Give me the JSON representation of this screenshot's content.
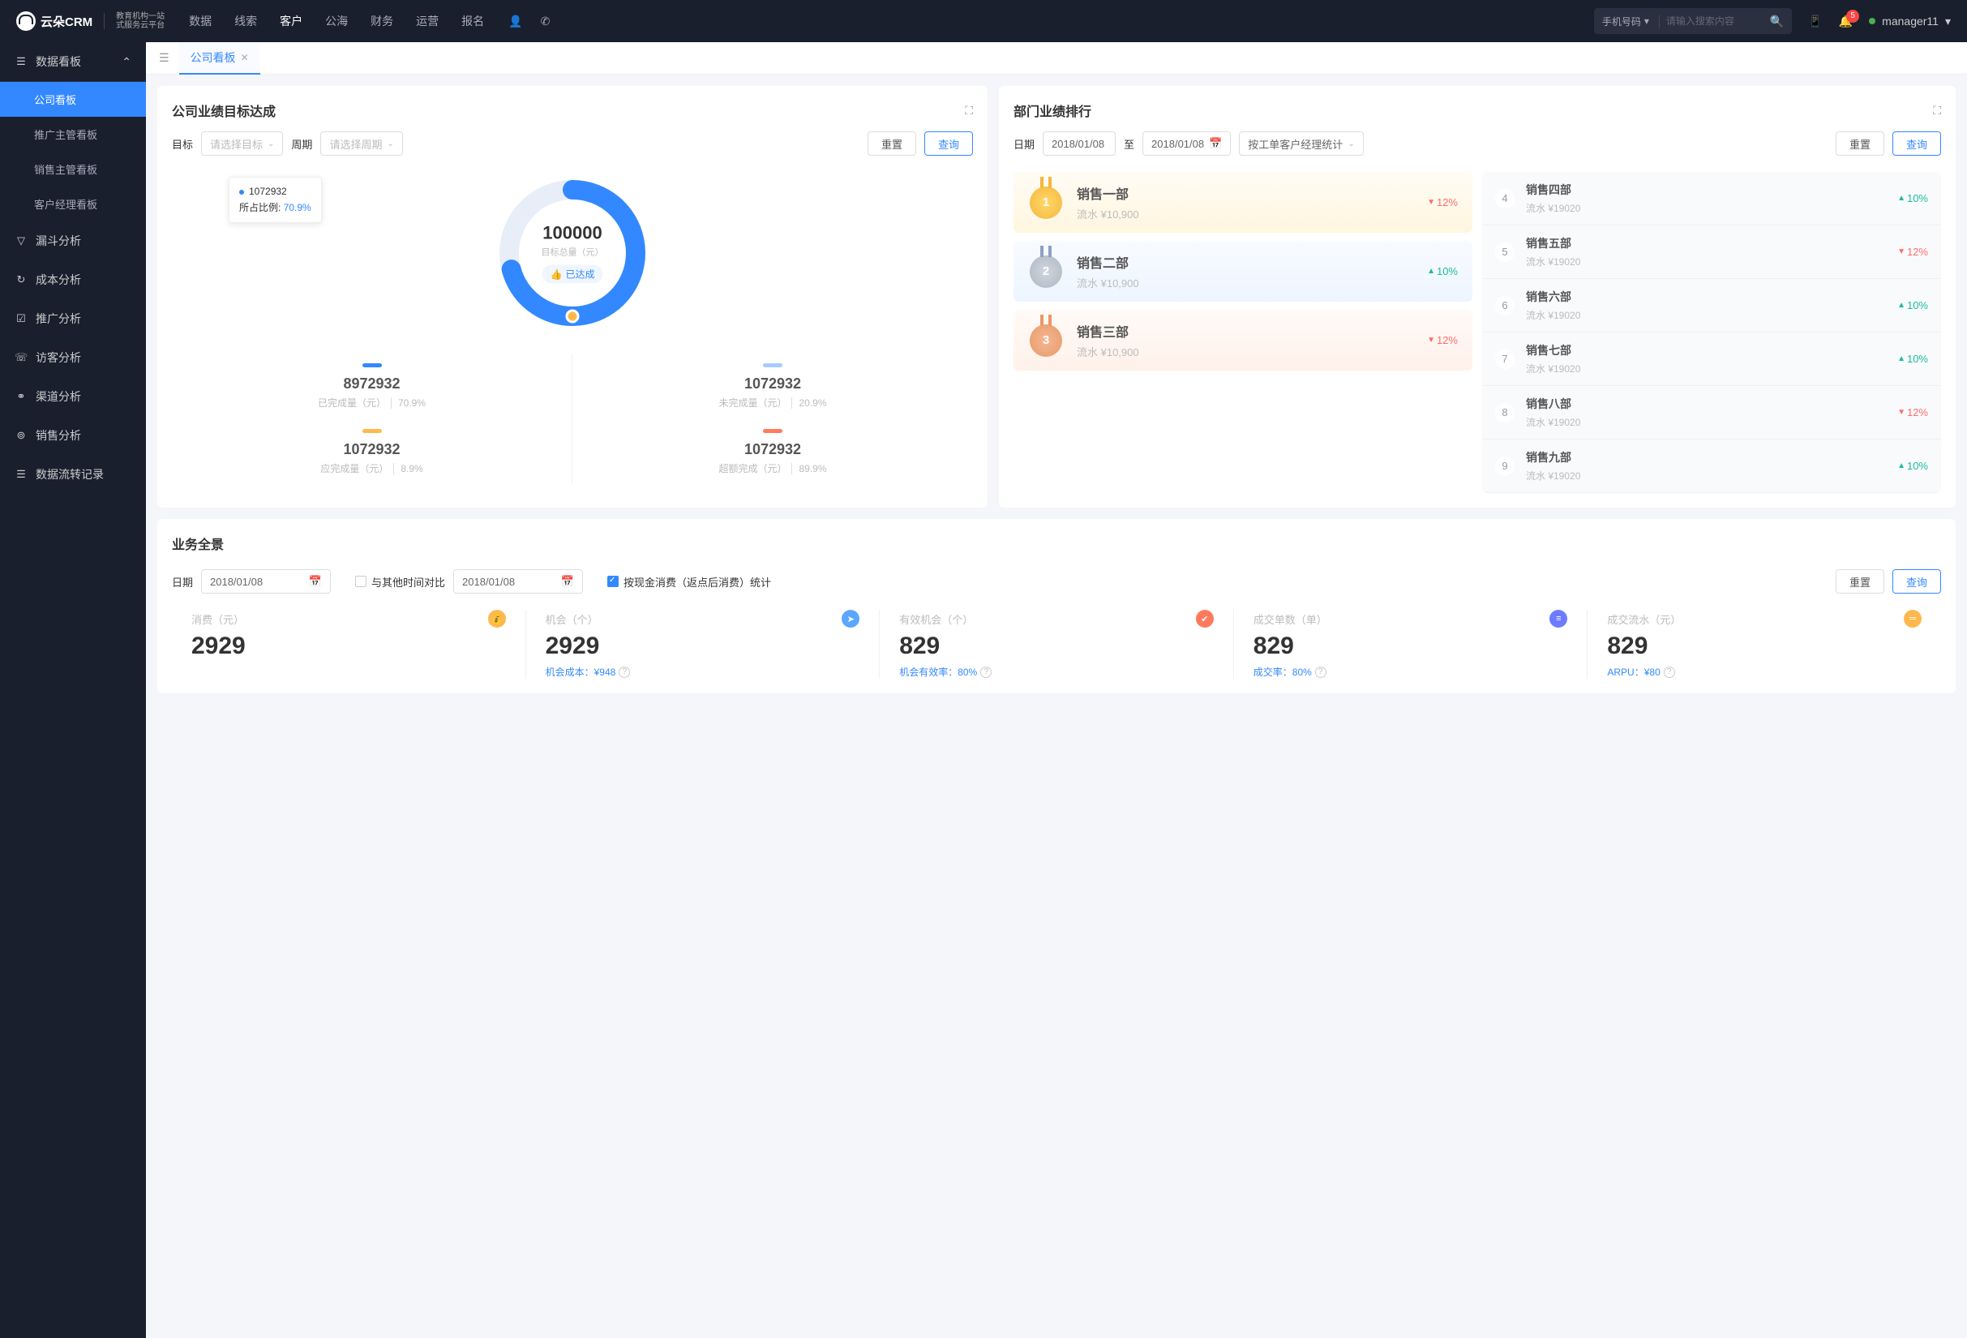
{
  "logo": {
    "brand": "云朵CRM",
    "sub1": "教育机构一站",
    "sub2": "式服务云平台"
  },
  "topnav": [
    "数据",
    "线索",
    "客户",
    "公海",
    "财务",
    "运营",
    "报名"
  ],
  "topnav_active": 2,
  "search": {
    "type": "手机号码",
    "placeholder": "请输入搜索内容"
  },
  "bell_count": "5",
  "user": "manager11",
  "sidebar": {
    "header": "数据看板",
    "subs": [
      "公司看板",
      "推广主管看板",
      "销售主管看板",
      "客户经理看板"
    ],
    "items": [
      "漏斗分析",
      "成本分析",
      "推广分析",
      "访客分析",
      "渠道分析",
      "销售分析",
      "数据流转记录"
    ],
    "icons": [
      "▽",
      "↻",
      "☑",
      "☏",
      "⚭",
      "⊚",
      "☰"
    ]
  },
  "tab": {
    "label": "公司看板"
  },
  "panel1": {
    "title": "公司业绩目标达成",
    "target_lbl": "目标",
    "target_ph": "请选择目标",
    "period_lbl": "周期",
    "period_ph": "请选择周期",
    "reset": "重置",
    "query": "查询",
    "tooltip_val": "1072932",
    "tooltip_lbl": "所占比例:",
    "tooltip_pct": "70.9%",
    "center_val": "100000",
    "center_lbl": "目标总量（元）",
    "badge": "已达成",
    "stats": [
      {
        "bar": "#3388ff",
        "val": "8972932",
        "lbl": "已完成量（元）",
        "pct": "70.9%"
      },
      {
        "bar": "#a8caff",
        "val": "1072932",
        "lbl": "未完成量（元）",
        "pct": "20.9%"
      },
      {
        "bar": "#ffb84d",
        "val": "1072932",
        "lbl": "应完成量（元）",
        "pct": "8.9%"
      },
      {
        "bar": "#ff7b5c",
        "val": "1072932",
        "lbl": "超额完成（元）",
        "pct": "89.9%"
      }
    ]
  },
  "panel2": {
    "title": "部门业绩排行",
    "date_lbl": "日期",
    "date1": "2018/01/08",
    "to": "至",
    "date2": "2018/01/08",
    "stat_by": "按工单客户经理统计",
    "reset": "重置",
    "query": "查询",
    "top3": [
      {
        "name": "销售一部",
        "sub": "流水 ¥10,900",
        "pct": "12%",
        "dir": "down"
      },
      {
        "name": "销售二部",
        "sub": "流水 ¥10,900",
        "pct": "10%",
        "dir": "up"
      },
      {
        "name": "销售三部",
        "sub": "流水 ¥10,900",
        "pct": "12%",
        "dir": "down"
      }
    ],
    "rest": [
      {
        "n": "4",
        "name": "销售四部",
        "sub": "流水 ¥19020",
        "pct": "10%",
        "dir": "up"
      },
      {
        "n": "5",
        "name": "销售五部",
        "sub": "流水 ¥19020",
        "pct": "12%",
        "dir": "down"
      },
      {
        "n": "6",
        "name": "销售六部",
        "sub": "流水 ¥19020",
        "pct": "10%",
        "dir": "up"
      },
      {
        "n": "7",
        "name": "销售七部",
        "sub": "流水 ¥19020",
        "pct": "10%",
        "dir": "up"
      },
      {
        "n": "8",
        "name": "销售八部",
        "sub": "流水 ¥19020",
        "pct": "12%",
        "dir": "down"
      },
      {
        "n": "9",
        "name": "销售九部",
        "sub": "流水 ¥19020",
        "pct": "10%",
        "dir": "up"
      }
    ]
  },
  "panel3": {
    "title": "业务全景",
    "date_lbl": "日期",
    "date1": "2018/01/08",
    "compare_lbl": "与其他时间对比",
    "date2": "2018/01/08",
    "cash_lbl": "按现金消费（返点后消费）统计",
    "reset": "重置",
    "query": "查询",
    "kpis": [
      {
        "lbl": "消费（元）",
        "ico": "💰",
        "bg": "#ffb84d",
        "val": "2929",
        "sub": ""
      },
      {
        "lbl": "机会（个）",
        "ico": "➤",
        "bg": "#5ba7ff",
        "val": "2929",
        "sub_l": "机会成本：",
        "sub_v": "¥948"
      },
      {
        "lbl": "有效机会（个）",
        "ico": "✔",
        "bg": "#ff7a5c",
        "val": "829",
        "sub_l": "机会有效率：",
        "sub_v": "80%"
      },
      {
        "lbl": "成交单数（单）",
        "ico": "≡",
        "bg": "#6b7cff",
        "val": "829",
        "sub_l": "成交率：",
        "sub_v": "80%"
      },
      {
        "lbl": "成交流水（元）",
        "ico": "═",
        "bg": "#ffb84d",
        "val": "829",
        "sub_l": "ARPU：",
        "sub_v": "¥80"
      }
    ]
  },
  "chart_data": {
    "type": "pie",
    "title": "公司业绩目标达成",
    "total_label": "目标总量（元）",
    "total": 100000,
    "series": [
      {
        "name": "已完成量（元）",
        "value": 8972932,
        "pct": 70.9,
        "color": "#3388ff"
      },
      {
        "name": "未完成量（元）",
        "value": 1072932,
        "pct": 20.9,
        "color": "#a8caff"
      },
      {
        "name": "应完成量（元）",
        "value": 1072932,
        "pct": 8.9,
        "color": "#ffb84d"
      },
      {
        "name": "超额完成（元）",
        "value": 1072932,
        "pct": 89.9,
        "color": "#ff7b5c"
      }
    ],
    "tooltip": {
      "value": 1072932,
      "label": "所占比例",
      "pct": 70.9
    }
  }
}
